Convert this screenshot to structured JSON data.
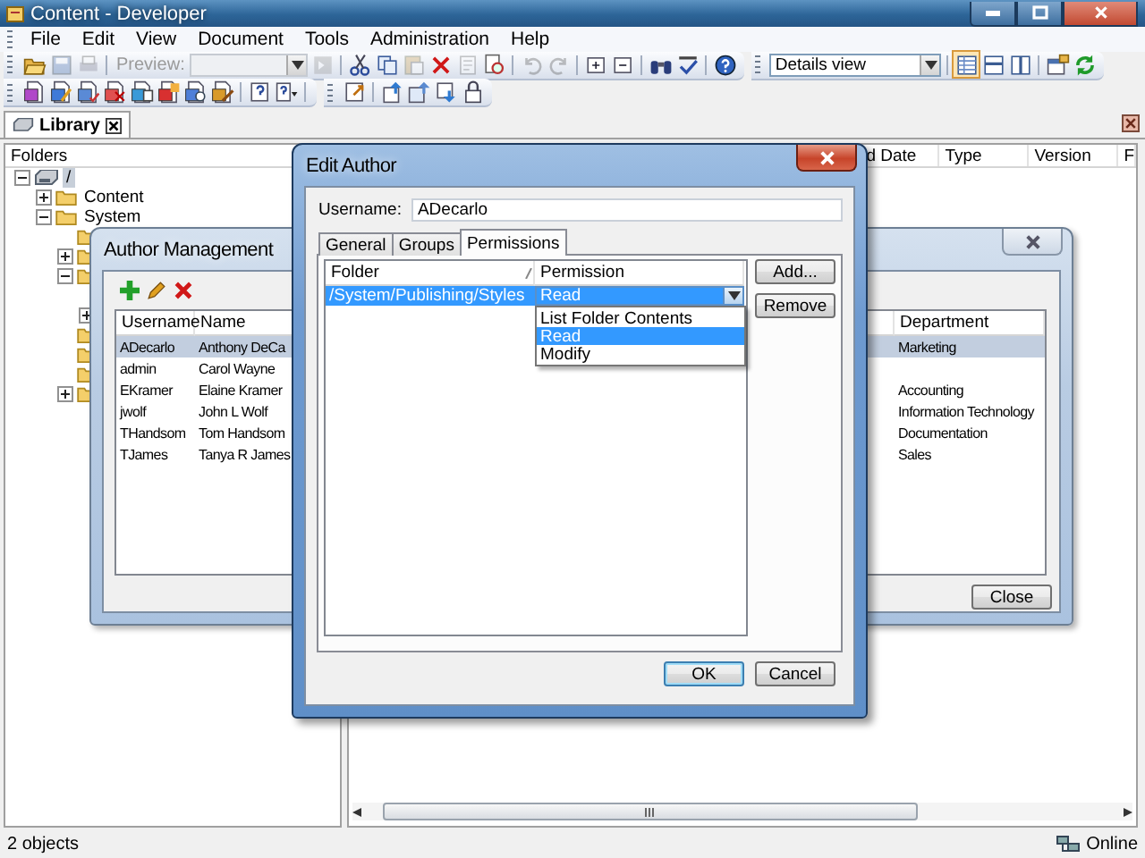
{
  "window": {
    "title": "Content - Developer"
  },
  "menu": [
    "File",
    "Edit",
    "View",
    "Document",
    "Tools",
    "Administration",
    "Help"
  ],
  "toolbar_1": {
    "items": [
      {
        "kind": "open",
        "disabled": false
      },
      {
        "kind": "save",
        "disabled": true
      },
      {
        "kind": "print",
        "disabled": true
      },
      {
        "kind": "sep"
      },
      {
        "kind": "label",
        "text": "Preview:",
        "disabled": true
      },
      {
        "kind": "combo",
        "disabled": true
      },
      {
        "kind": "go",
        "disabled": true
      },
      {
        "kind": "sep"
      },
      {
        "kind": "cut",
        "disabled": false
      },
      {
        "kind": "copy",
        "disabled": false
      },
      {
        "kind": "paste",
        "disabled": true
      },
      {
        "kind": "delete",
        "disabled": false
      },
      {
        "kind": "props",
        "disabled": true
      },
      {
        "kind": "find-doc",
        "disabled": false
      },
      {
        "kind": "sep"
      },
      {
        "kind": "undo",
        "disabled": true
      },
      {
        "kind": "redo",
        "disabled": true
      },
      {
        "kind": "sep"
      },
      {
        "kind": "expand",
        "disabled": false
      },
      {
        "kind": "collapse",
        "disabled": false
      },
      {
        "kind": "sep"
      },
      {
        "kind": "binoculars",
        "disabled": false
      },
      {
        "kind": "spell",
        "disabled": false
      },
      {
        "kind": "sep"
      },
      {
        "kind": "help",
        "disabled": false
      }
    ],
    "view_select": "Details view",
    "views": [
      {
        "kind": "details",
        "selected": true
      },
      {
        "kind": "rows",
        "selected": false
      },
      {
        "kind": "columns",
        "selected": false
      }
    ],
    "extras": [
      {
        "kind": "options"
      },
      {
        "kind": "refresh"
      }
    ]
  },
  "toolbar_2": [
    {
      "kind": "doc-new"
    },
    {
      "kind": "doc-edit"
    },
    {
      "kind": "doc-check"
    },
    {
      "kind": "doc-delete"
    },
    {
      "kind": "doc-move"
    },
    {
      "kind": "doc-red"
    },
    {
      "kind": "doc-find"
    },
    {
      "kind": "doc-tools"
    },
    {
      "kind": "sep"
    },
    {
      "kind": "query"
    },
    {
      "kind": "query-menu"
    },
    {
      "kind": "sep"
    },
    {
      "kind": "export"
    },
    {
      "kind": "sep"
    },
    {
      "kind": "up"
    },
    {
      "kind": "up-right"
    },
    {
      "kind": "down"
    },
    {
      "kind": "lock"
    }
  ],
  "tabs": [
    {
      "label": "Library",
      "selected": true
    }
  ],
  "folders": {
    "header": "Folders",
    "tree": [
      {
        "label": "/",
        "kind": "drive",
        "selected": true,
        "expanded": true,
        "children": [
          {
            "label": "Content",
            "selected": false,
            "expanded": false
          },
          {
            "label": "System",
            "selected": false,
            "expanded": true,
            "children": [
              {
                "icon": true
              },
              {
                "icon": true,
                "expanded": false
              },
              {
                "icon": true,
                "expanded": true,
                "children": [
                  {
                    "icon": false
                  },
                  {
                    "icon": false,
                    "expanded": false
                  }
                ]
              },
              {
                "icon": true
              },
              {
                "icon": true
              },
              {
                "icon": true
              },
              {
                "icon": true,
                "expanded": false
              }
            ]
          }
        ]
      }
    ]
  },
  "list": {
    "columns": [
      "d Date",
      "Type",
      "Version",
      "F"
    ]
  },
  "status_bar": {
    "text": "2 objects",
    "connection": "Online"
  },
  "author_management": {
    "title": "Author Management",
    "columns": [
      "Username",
      "Name",
      "Department"
    ],
    "rows": [
      {
        "username": "ADecarlo",
        "name": "Anthony DeCa",
        "department": "Marketing",
        "selected": true
      },
      {
        "username": "admin",
        "name": "Carol Wayne",
        "selected": false
      },
      {
        "username": "EKramer",
        "name": "Elaine Kramer",
        "department": "Accounting",
        "selected": false
      },
      {
        "username": "jwolf",
        "name": "John L Wolf",
        "department": "Information Technology",
        "selected": false
      },
      {
        "username": "THandsom",
        "name": "Tom Handsom",
        "department": "Documentation",
        "selected": false
      },
      {
        "username": "TJames",
        "name": "Tanya R James",
        "department": "Sales",
        "selected": false
      }
    ],
    "close": "Close"
  },
  "edit_author": {
    "title": "Edit Author",
    "username_label": "Username:",
    "username": "ADecarlo",
    "tabs": [
      {
        "label": "General",
        "selected": false
      },
      {
        "label": "Groups",
        "selected": false
      },
      {
        "label": "Permissions",
        "selected": true
      }
    ],
    "columns": [
      "Folder",
      "Permission"
    ],
    "rows": [
      {
        "folder": "/System/Publishing/Styles",
        "permission": "Read",
        "selected": true
      }
    ],
    "dropdown": [
      {
        "label": "List Folder Contents",
        "selected": false
      },
      {
        "label": "Read",
        "selected": true
      },
      {
        "label": "Modify",
        "selected": false
      }
    ],
    "side_buttons": [
      "Add...",
      "Remove"
    ],
    "footer": [
      {
        "label": "OK",
        "default": true
      },
      {
        "label": "Cancel",
        "default": false
      }
    ]
  }
}
